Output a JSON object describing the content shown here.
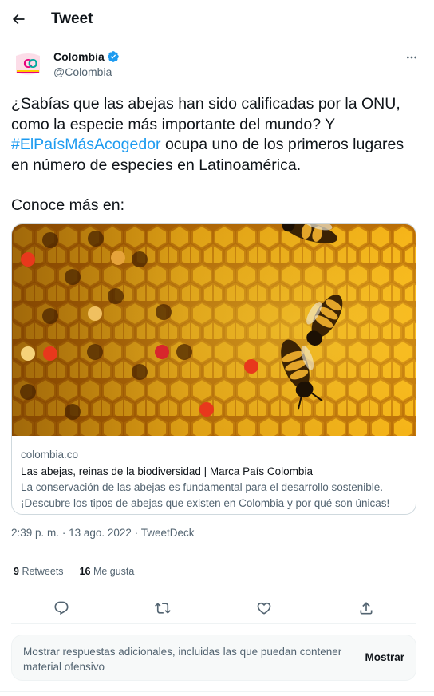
{
  "header": {
    "title": "Tweet"
  },
  "author": {
    "name": "Colombia",
    "handle": "@Colombia",
    "avatar_text": "CO",
    "avatar_subtext": "COLOMBIA",
    "verified": true
  },
  "tweet": {
    "text_before_hashtag": "¿Sabías que las abejas han sido calificadas por la ONU, como la especie más importante del mundo? Y ",
    "hashtag": "#ElPaísMásAcogedor",
    "text_after_hashtag": " ocupa uno de los primeros lugares en número de especies en Latinoamérica.",
    "second_paragraph": "Conoce más en:"
  },
  "card": {
    "domain": "colombia.co",
    "title": "Las abejas, reinas de la biodiversidad | Marca País Colombia",
    "description": "La conservación de las abejas es fundamental para el desarrollo sostenible. ¡Descubre los tipos de abejas que existen en Colombia y por qué son únicas!"
  },
  "meta": {
    "time": "2:39 p. m.",
    "separator": "·",
    "date": "13 ago. 2022",
    "source": "TweetDeck"
  },
  "stats": {
    "retweets_count": "9",
    "retweets_label": "Retweets",
    "likes_count": "16",
    "likes_label": "Me gusta"
  },
  "more_replies": {
    "text": "Mostrar respuestas adicionales, incluidas las que puedan contener material ofensivo",
    "button_label": "Mostrar"
  },
  "colors": {
    "hashtag": "#1d9bf0",
    "verified": "#1d9bf0",
    "secondary_text": "#536471",
    "primary_text": "#0f1419",
    "border": "#cfd9de"
  },
  "icons": {
    "back": "arrow-left-icon",
    "verified": "verified-badge-icon",
    "more": "more-dots-icon",
    "reply": "reply-icon",
    "retweet": "retweet-icon",
    "like": "heart-icon",
    "share": "share-icon"
  }
}
